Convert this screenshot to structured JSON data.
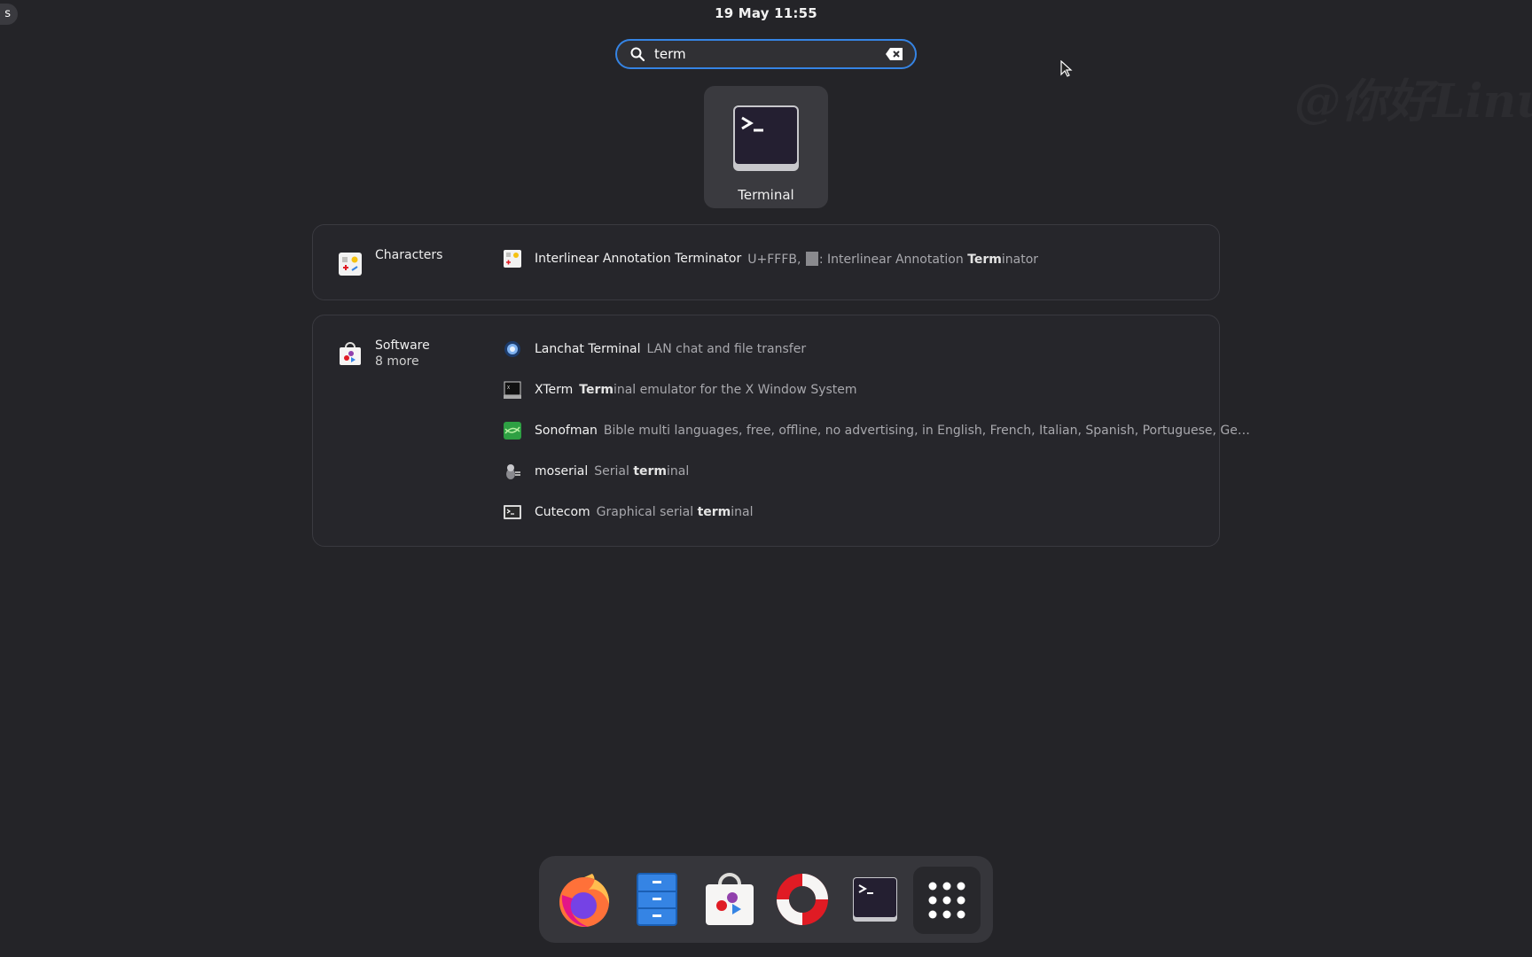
{
  "topbar": {
    "activities_label": "s",
    "clock": "19 May  11:55"
  },
  "watermark": "@你好Linu",
  "search": {
    "value": "term"
  },
  "top_app": {
    "label": "Terminal"
  },
  "providers": {
    "characters": {
      "name": "Characters",
      "results": [
        {
          "title": "Interlinear Annotation Terminator",
          "desc_prefix": "U+FFFB, ",
          "desc_suffix": ": Interlinear Annotation ",
          "desc_bold": "Term",
          "desc_rest": "inator"
        }
      ]
    },
    "software": {
      "name": "Software",
      "more": "8 more",
      "results": [
        {
          "title": "Lanchat Terminal",
          "desc": "LAN chat and file transfer"
        },
        {
          "title": "XTerm",
          "desc_bold": "Term",
          "desc": "inal emulator for the X Window System"
        },
        {
          "title": "Sonofman",
          "desc": "Bible multi languages, free, offline, no advertising, in English, French, Italian, Spanish, Portuguese, Ge…"
        },
        {
          "title": "moserial",
          "desc_pre": "Serial ",
          "desc_bold": "term",
          "desc": "inal"
        },
        {
          "title": "Cutecom",
          "desc_pre": "Graphical serial ",
          "desc_bold": "term",
          "desc": "inal"
        }
      ]
    }
  },
  "dock": {
    "items": [
      "firefox-icon",
      "files-icon",
      "software-icon",
      "help-icon",
      "terminal-icon",
      "show-apps-icon"
    ]
  },
  "colors": {
    "background": "#242428",
    "accent": "#3584e4",
    "panel_border": "#3a3a40"
  }
}
